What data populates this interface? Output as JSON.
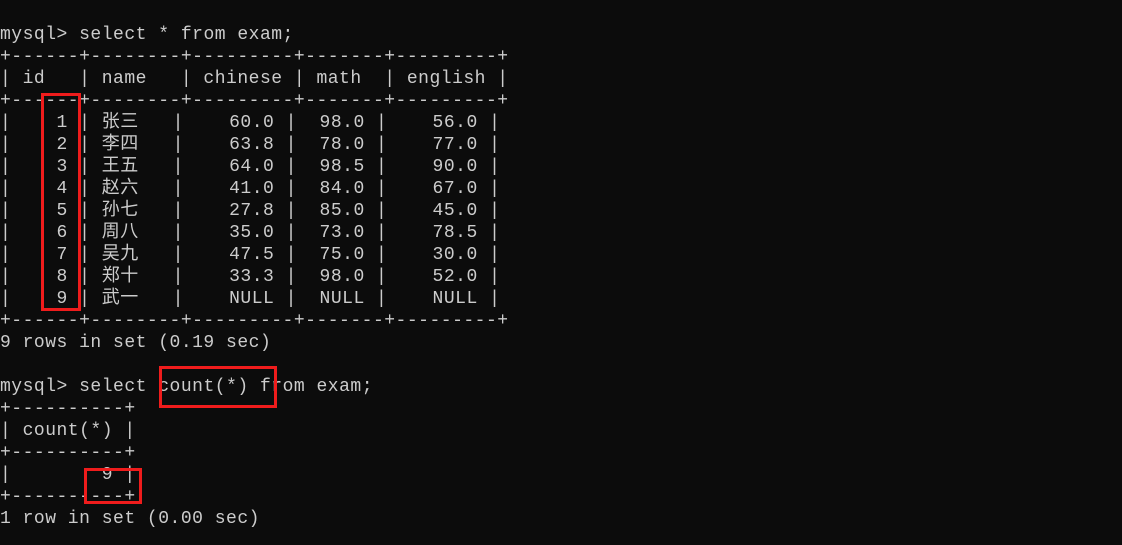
{
  "prompt": "mysql>",
  "query1": "select * from exam;",
  "table1": {
    "border_top": "+------+--------+---------+-------+---------+",
    "header": "| id   | name   | chinese | math  | english |",
    "border_mid": "+------+--------+---------+-------+---------+",
    "rows": [
      "|    1 | 张三   |    60.0 |  98.0 |    56.0 |",
      "|    2 | 李四   |    63.8 |  78.0 |    77.0 |",
      "|    3 | 王五   |    64.0 |  98.5 |    90.0 |",
      "|    4 | 赵六   |    41.0 |  84.0 |    67.0 |",
      "|    5 | 孙七   |    27.8 |  85.0 |    45.0 |",
      "|    6 | 周八   |    35.0 |  73.0 |    78.5 |",
      "|    7 | 吴九   |    47.5 |  75.0 |    30.0 |",
      "|    8 | 郑十   |    33.3 |  98.0 |    52.0 |",
      "|    9 | 武一   |    NULL |  NULL |    NULL |"
    ],
    "border_bot": "+------+--------+---------+-------+---------+"
  },
  "result1_status": "9 rows in set (0.19 sec)",
  "blank": "",
  "query2_pre": "select ",
  "query2_fn": "count(*)",
  "query2_post": " from exam;",
  "table2": {
    "border_top": "+----------+",
    "header": "| count(*) |",
    "border_mid": "+----------+",
    "row": "|        9 |",
    "border_bot": "+----------+"
  },
  "result2_status": "1 row in set (0.00 sec)",
  "chart_data": {
    "type": "table",
    "columns": [
      "id",
      "name",
      "chinese",
      "math",
      "english"
    ],
    "rows": [
      {
        "id": 1,
        "name": "张三",
        "chinese": 60.0,
        "math": 98.0,
        "english": 56.0
      },
      {
        "id": 2,
        "name": "李四",
        "chinese": 63.8,
        "math": 78.0,
        "english": 77.0
      },
      {
        "id": 3,
        "name": "王五",
        "chinese": 64.0,
        "math": 98.5,
        "english": 90.0
      },
      {
        "id": 4,
        "name": "赵六",
        "chinese": 41.0,
        "math": 84.0,
        "english": 67.0
      },
      {
        "id": 5,
        "name": "孙七",
        "chinese": 27.8,
        "math": 85.0,
        "english": 45.0
      },
      {
        "id": 6,
        "name": "周八",
        "chinese": 35.0,
        "math": 73.0,
        "english": 78.5
      },
      {
        "id": 7,
        "name": "吴九",
        "chinese": 47.5,
        "math": 75.0,
        "english": 30.0
      },
      {
        "id": 8,
        "name": "郑十",
        "chinese": 33.3,
        "math": 98.0,
        "english": 52.0
      },
      {
        "id": 9,
        "name": "武一",
        "chinese": null,
        "math": null,
        "english": null
      }
    ],
    "aggregate": {
      "count(*)": 9
    }
  }
}
